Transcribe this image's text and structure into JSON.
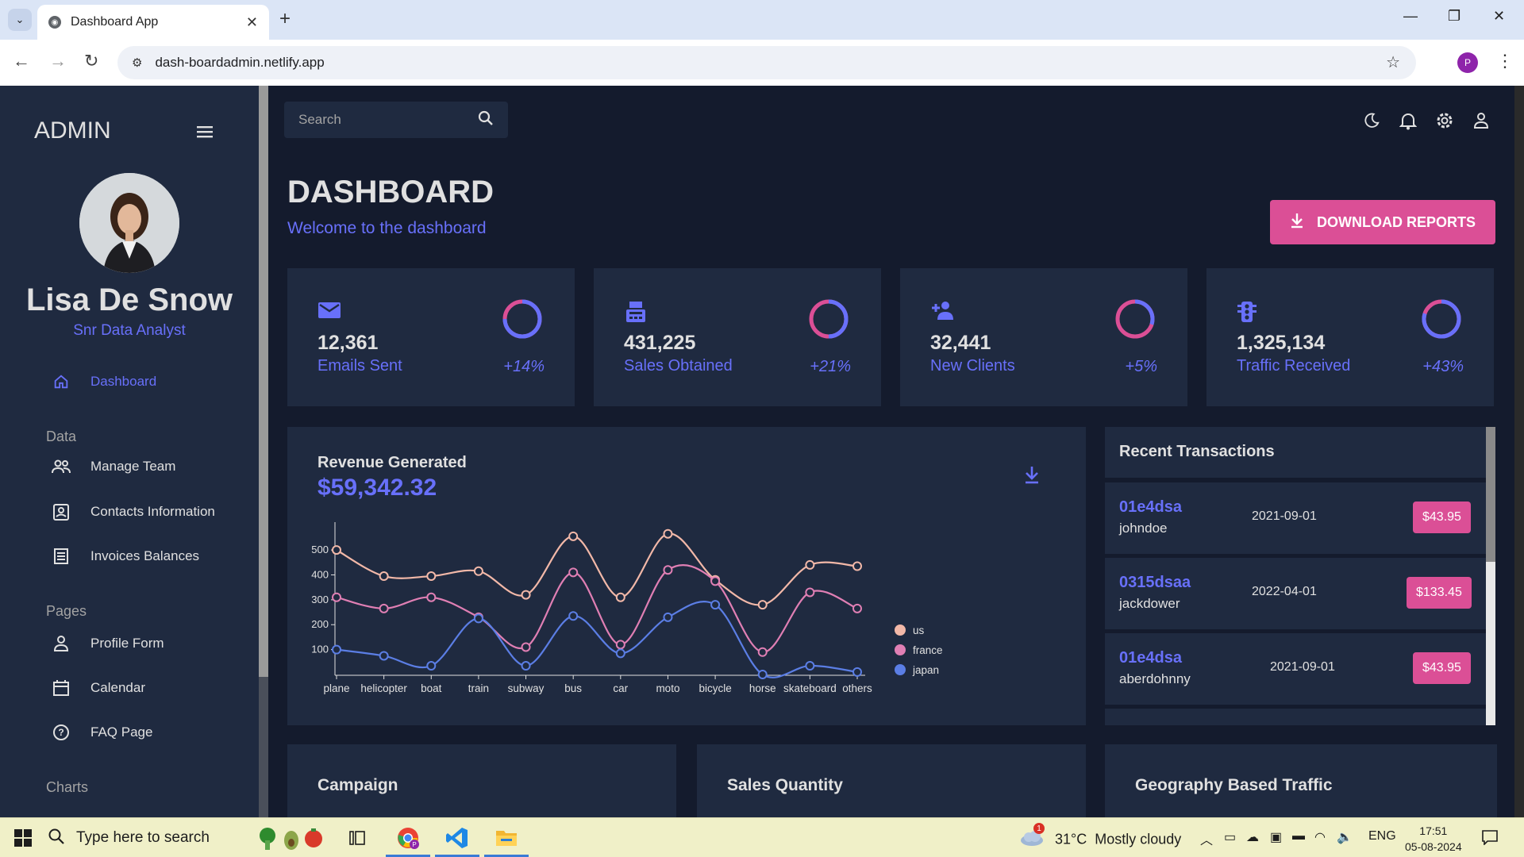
{
  "browser": {
    "tab_title": "Dashboard App",
    "url": "dash-boardadmin.netlify.app",
    "profile_initial": "P"
  },
  "sidebar": {
    "title": "ADMIN",
    "user_name": "Lisa De Snow",
    "user_role": "Snr Data Analyst",
    "sections": [
      "Data",
      "Pages",
      "Charts"
    ],
    "items": [
      {
        "label": "Dashboard",
        "icon": "home-icon",
        "active": true
      },
      {
        "label": "Manage Team",
        "icon": "people-icon"
      },
      {
        "label": "Contacts Information",
        "icon": "contacts-icon"
      },
      {
        "label": "Invoices Balances",
        "icon": "receipt-icon"
      },
      {
        "label": "Profile Form",
        "icon": "person-icon"
      },
      {
        "label": "Calendar",
        "icon": "calendar-icon"
      },
      {
        "label": "FAQ Page",
        "icon": "help-icon"
      }
    ]
  },
  "topbar": {
    "search_placeholder": "Search",
    "icons": [
      "dark-mode-icon",
      "notifications-icon",
      "settings-icon",
      "person-icon"
    ]
  },
  "header": {
    "title": "DASHBOARD",
    "subtitle": "Welcome to the dashboard",
    "download_label": "DOWNLOAD REPORTS"
  },
  "stats": [
    {
      "value": "12,361",
      "label": "Emails Sent",
      "increase": "+14%",
      "progress": 0.75,
      "icon": "email-icon"
    },
    {
      "value": "431,225",
      "label": "Sales Obtained",
      "increase": "+21%",
      "progress": 0.5,
      "icon": "point-of-sale-icon"
    },
    {
      "value": "32,441",
      "label": "New Clients",
      "increase": "+5%",
      "progress": 0.3,
      "icon": "person-add-icon"
    },
    {
      "value": "1,325,134",
      "label": "Traffic Received",
      "increase": "+43%",
      "progress": 0.8,
      "icon": "traffic-icon"
    }
  ],
  "revenue": {
    "title": "Revenue Generated",
    "value": "$59,342.32"
  },
  "chart_data": {
    "type": "line",
    "categories": [
      "plane",
      "helicopter",
      "boat",
      "train",
      "subway",
      "bus",
      "car",
      "moto",
      "bicycle",
      "horse",
      "skateboard",
      "others"
    ],
    "series": [
      {
        "name": "us",
        "color": "#f2b8a8",
        "values": [
          500,
          395,
          395,
          415,
          320,
          555,
          310,
          565,
          380,
          280,
          440,
          435
        ]
      },
      {
        "name": "france",
        "color": "#e07fb4",
        "values": [
          310,
          265,
          310,
          230,
          110,
          410,
          120,
          420,
          375,
          90,
          330,
          265
        ]
      },
      {
        "name": "japan",
        "color": "#5b7ee5",
        "values": [
          100,
          75,
          35,
          225,
          35,
          235,
          85,
          230,
          280,
          0,
          35,
          10
        ]
      }
    ],
    "y_ticks": [
      100,
      200,
      300,
      400,
      500
    ],
    "ylim": [
      0,
      580
    ],
    "legend_position": "right"
  },
  "transactions": {
    "title": "Recent Transactions",
    "rows": [
      {
        "id": "01e4dsa",
        "user": "johndoe",
        "date": "2021-09-01",
        "cost": "$43.95"
      },
      {
        "id": "0315dsaa",
        "user": "jackdower",
        "date": "2022-04-01",
        "cost": "$133.45"
      },
      {
        "id": "01e4dsa",
        "user": "aberdohnny",
        "date": "2021-09-01",
        "cost": "$43.95"
      }
    ]
  },
  "bottom_cards": [
    "Campaign",
    "Sales Quantity",
    "Geography Based Traffic"
  ],
  "taskbar": {
    "search_placeholder": "Type here to search",
    "weather": "31°C  Mostly cloudy",
    "lang": "ENG",
    "time": "17:51",
    "date": "05-08-2024",
    "weather_badge": "1"
  }
}
